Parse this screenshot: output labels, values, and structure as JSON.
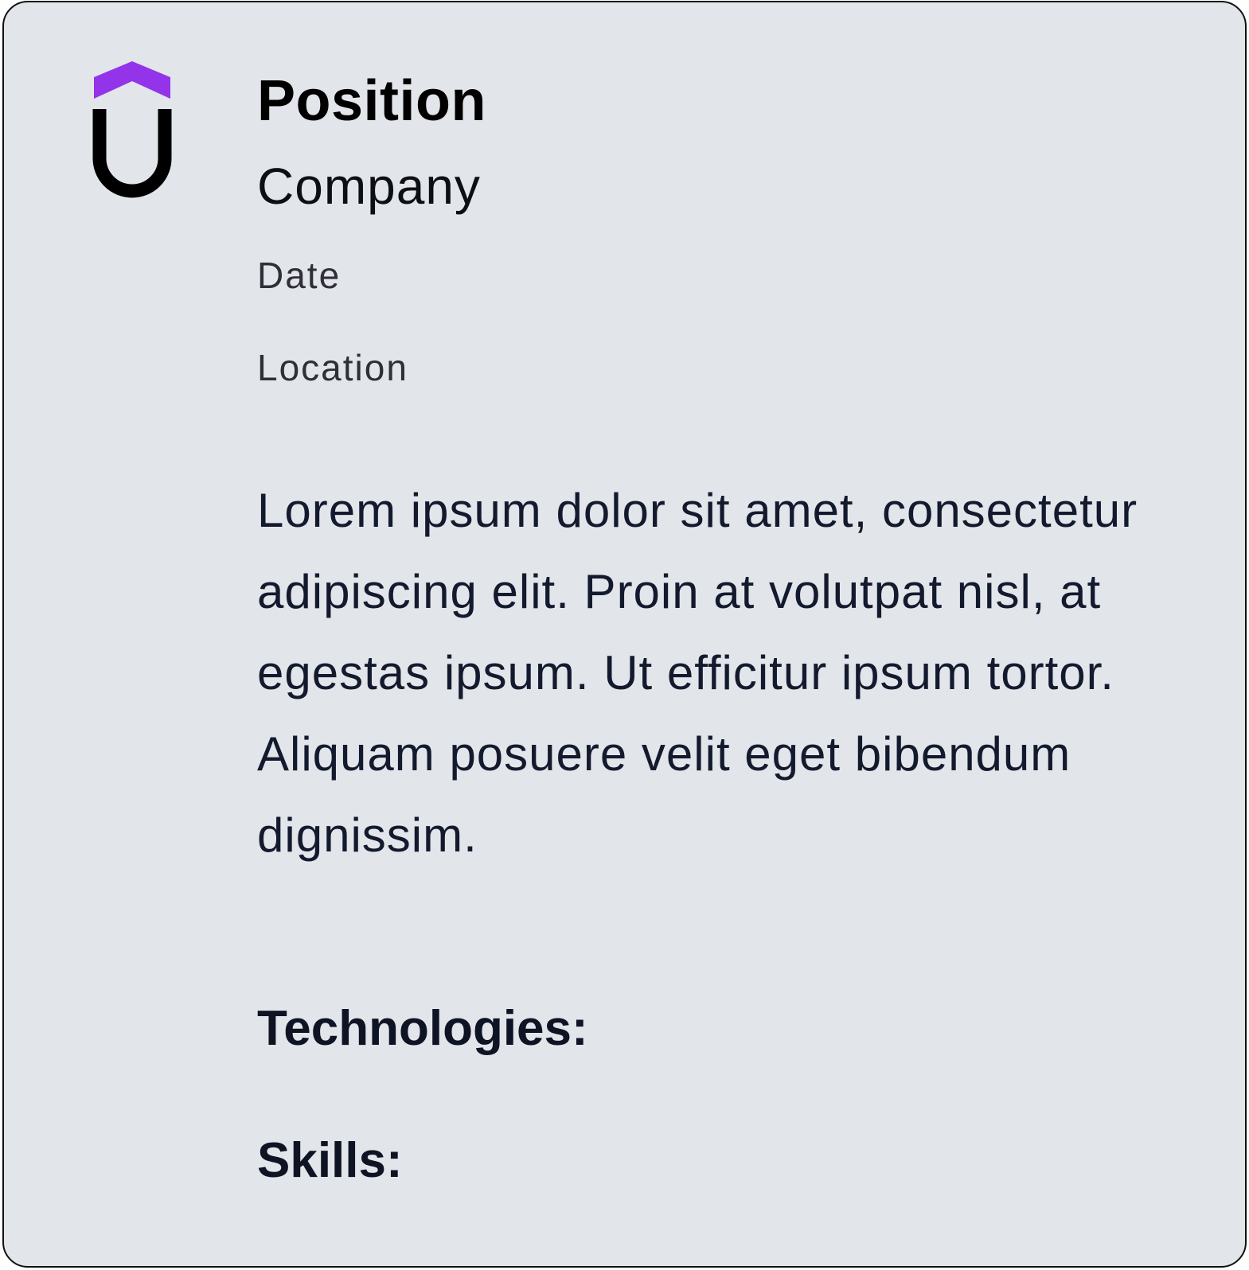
{
  "card": {
    "logo_icon": "company-logo-icon",
    "colors": {
      "background": "#e2e5ea",
      "border": "#111111",
      "logo_accent": "#9333ea",
      "logo_main": "#000000",
      "text": "#141a2e"
    },
    "position": "Position",
    "company": "Company",
    "date": "Date",
    "location": "Location",
    "description": "Lorem ipsum dolor sit amet, consectetur adipiscing elit. Proin at volutpat nisl, at egestas ipsum. Ut efficitur ipsum tortor. Aliquam posuere velit eget bibendum dignissim.",
    "technologies_label": "Technologies:",
    "skills_label": "Skills:"
  }
}
